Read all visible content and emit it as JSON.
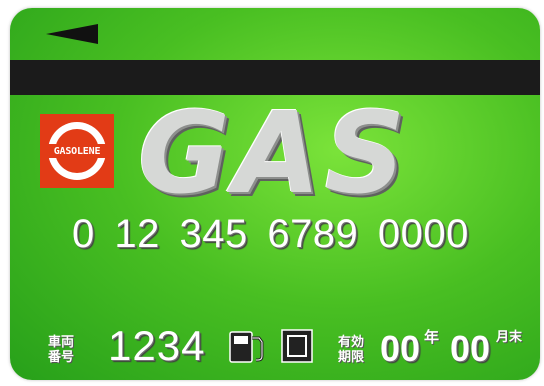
{
  "card": {
    "brand_logo_text": "GASOLENE",
    "title": "GAS",
    "card_number": "0 12 345 6789 0000",
    "vehicle_label_line1": "車両",
    "vehicle_label_line2": "番号",
    "vehicle_number": "1234",
    "expiry_label_line1": "有効",
    "expiry_label_line2": "期限",
    "expiry_year_value": "00",
    "year_unit": "年",
    "expiry_month_value": "00",
    "month_unit": "月末"
  },
  "icons": {
    "arrow": "arrow-left-icon",
    "fuel": "fuel-pump-icon",
    "square": "square-icon"
  },
  "colors": {
    "card_green": "#49bf22",
    "logo_red": "#e23b16",
    "stripe": "#1b1b1b"
  }
}
